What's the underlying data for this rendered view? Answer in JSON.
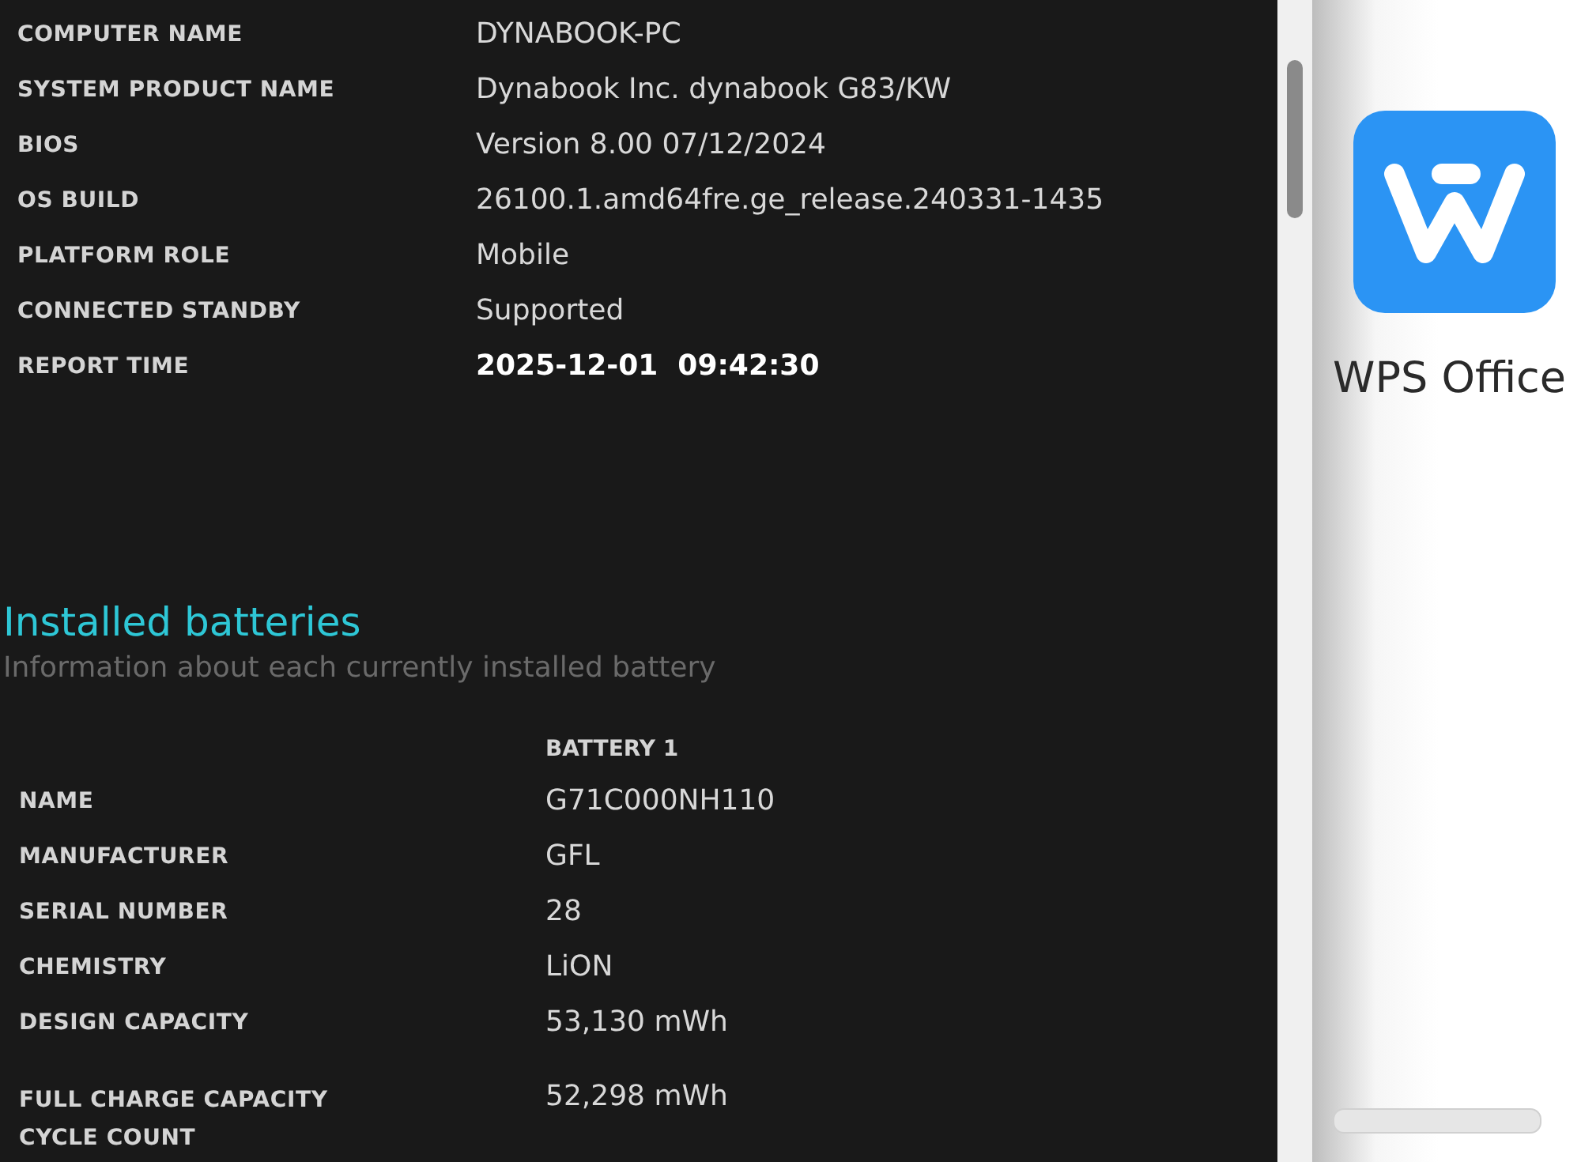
{
  "system_info": [
    {
      "label": "COMPUTER NAME",
      "value": "DYNABOOK-PC",
      "bold": false
    },
    {
      "label": "SYSTEM PRODUCT NAME",
      "value": "Dynabook Inc. dynabook G83/KW",
      "bold": false
    },
    {
      "label": "BIOS",
      "value": "Version 8.00 07/12/2024",
      "bold": false
    },
    {
      "label": "OS BUILD",
      "value": "26100.1.amd64fre.ge_release.240331-1435",
      "bold": false
    },
    {
      "label": "PLATFORM ROLE",
      "value": "Mobile",
      "bold": false
    },
    {
      "label": "CONNECTED STANDBY",
      "value": "Supported",
      "bold": false
    },
    {
      "label": "REPORT TIME",
      "value": "2025-12-01  09:42:30",
      "bold": true
    }
  ],
  "installed_batteries": {
    "title": "Installed batteries",
    "subtitle": "Information about each currently installed battery",
    "column": "BATTERY 1",
    "rows": [
      {
        "label": "NAME",
        "value": "G71C000NH110"
      },
      {
        "label": "MANUFACTURER",
        "value": "GFL"
      },
      {
        "label": "SERIAL NUMBER",
        "value": "28"
      },
      {
        "label": "CHEMISTRY",
        "value": "LiON"
      },
      {
        "label": "DESIGN CAPACITY",
        "value": "53,130 mWh"
      },
      {
        "label": "FULL CHARGE CAPACITY",
        "value": "52,298 mWh"
      },
      {
        "label": "CYCLE COUNT"
      }
    ]
  },
  "side_panel": {
    "app_name": "WPS Office"
  }
}
